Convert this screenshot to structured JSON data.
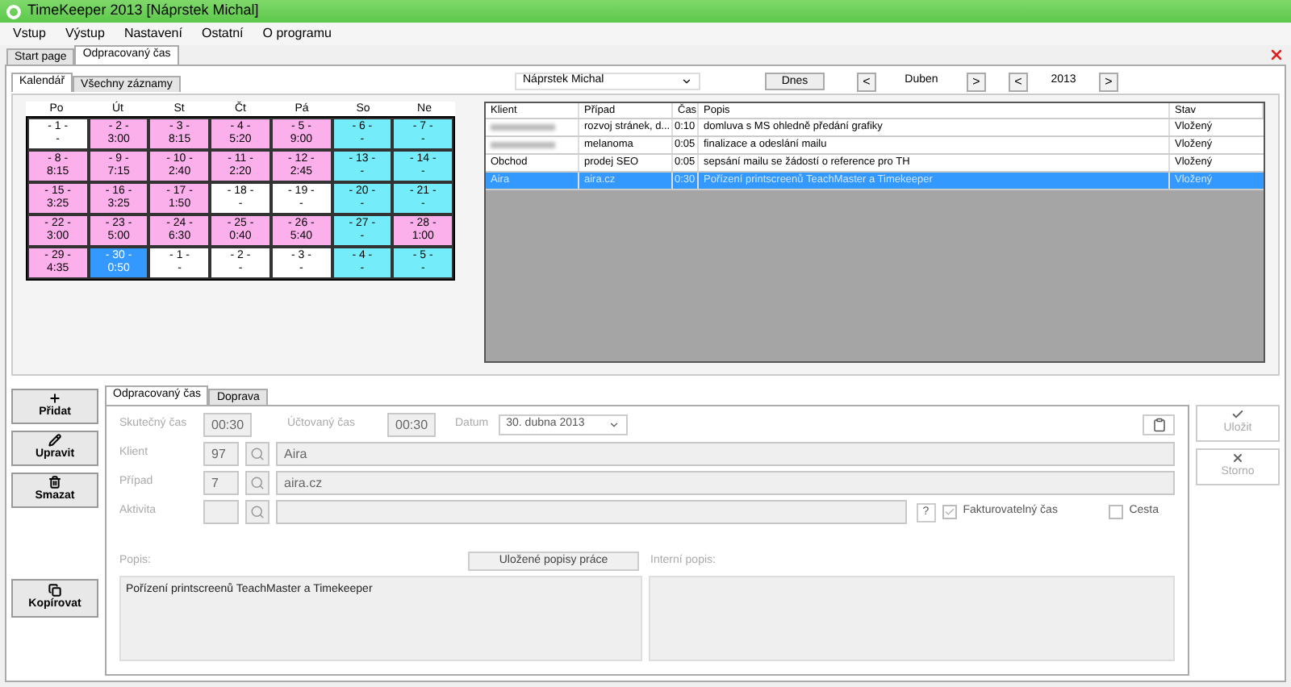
{
  "window": {
    "title": "TimeKeeper 2013 [Náprstek Michal]"
  },
  "menu": [
    "Vstup",
    "Výstup",
    "Nastavení",
    "Ostatní",
    "O programu"
  ],
  "doc_tabs": [
    {
      "label": "Start page",
      "selected": false
    },
    {
      "label": "Odpracovaný čas",
      "selected": true
    }
  ],
  "view_tabs": [
    {
      "label": "Kalendář",
      "selected": true
    },
    {
      "label": "Všechny záznamy",
      "selected": false
    }
  ],
  "user": "Náprstek Michal",
  "today_button": "Dnes",
  "month": {
    "prev": "<",
    "label": "Duben",
    "next": ">"
  },
  "year": {
    "prev": "<",
    "label": "2013",
    "next": ">"
  },
  "weekdays": [
    "Po",
    "Út",
    "St",
    "Čt",
    "Pá",
    "So",
    "Ne"
  ],
  "weeks": [
    [
      {
        "day": "- 1 -",
        "time": "-",
        "kind": "empty",
        "selected": false
      },
      {
        "day": "- 2 -",
        "time": "3:00",
        "kind": "worked",
        "selected": false
      },
      {
        "day": "- 3 -",
        "time": "8:15",
        "kind": "worked",
        "selected": false
      },
      {
        "day": "- 4 -",
        "time": "5:20",
        "kind": "worked",
        "selected": false
      },
      {
        "day": "- 5 -",
        "time": "9:00",
        "kind": "worked",
        "selected": false
      },
      {
        "day": "- 6 -",
        "time": "-",
        "kind": "weekend",
        "selected": false
      },
      {
        "day": "- 7 -",
        "time": "-",
        "kind": "weekend",
        "selected": false
      }
    ],
    [
      {
        "day": "- 8 -",
        "time": "8:15",
        "kind": "worked",
        "selected": false
      },
      {
        "day": "- 9 -",
        "time": "7:15",
        "kind": "worked",
        "selected": false
      },
      {
        "day": "- 10 -",
        "time": "2:40",
        "kind": "worked",
        "selected": false
      },
      {
        "day": "- 11 -",
        "time": "2:20",
        "kind": "worked",
        "selected": false
      },
      {
        "day": "- 12 -",
        "time": "2:45",
        "kind": "worked",
        "selected": false
      },
      {
        "day": "- 13 -",
        "time": "-",
        "kind": "weekend",
        "selected": false
      },
      {
        "day": "- 14 -",
        "time": "-",
        "kind": "weekend",
        "selected": false
      }
    ],
    [
      {
        "day": "- 15 -",
        "time": "3:25",
        "kind": "worked",
        "selected": false
      },
      {
        "day": "- 16 -",
        "time": "3:25",
        "kind": "worked",
        "selected": false
      },
      {
        "day": "- 17 -",
        "time": "1:50",
        "kind": "worked",
        "selected": false
      },
      {
        "day": "- 18 -",
        "time": "-",
        "kind": "empty",
        "selected": false
      },
      {
        "day": "- 19 -",
        "time": "-",
        "kind": "empty",
        "selected": false
      },
      {
        "day": "- 20 -",
        "time": "-",
        "kind": "weekend",
        "selected": false
      },
      {
        "day": "- 21 -",
        "time": "-",
        "kind": "weekend",
        "selected": false
      }
    ],
    [
      {
        "day": "- 22 -",
        "time": "3:00",
        "kind": "worked",
        "selected": false
      },
      {
        "day": "- 23 -",
        "time": "5:00",
        "kind": "worked",
        "selected": false
      },
      {
        "day": "- 24 -",
        "time": "6:30",
        "kind": "worked",
        "selected": false
      },
      {
        "day": "- 25 -",
        "time": "0:40",
        "kind": "worked",
        "selected": false
      },
      {
        "day": "- 26 -",
        "time": "5:40",
        "kind": "worked",
        "selected": false
      },
      {
        "day": "- 27 -",
        "time": "-",
        "kind": "weekend",
        "selected": false
      },
      {
        "day": "- 28 -",
        "time": "1:00",
        "kind": "worked",
        "selected": false
      }
    ],
    [
      {
        "day": "- 29 -",
        "time": "4:35",
        "kind": "worked",
        "selected": false
      },
      {
        "day": "- 30 -",
        "time": "0:50",
        "selected": true
      },
      {
        "day": "- 1 -",
        "time": "-",
        "kind": "empty",
        "selected": false
      },
      {
        "day": "- 2 -",
        "time": "-",
        "kind": "empty",
        "selected": false
      },
      {
        "day": "- 3 -",
        "time": "-",
        "kind": "empty",
        "selected": false
      },
      {
        "day": "- 4 -",
        "time": "-",
        "kind": "weekend",
        "selected": false
      },
      {
        "day": "- 5 -",
        "time": "-",
        "kind": "weekend",
        "selected": false
      }
    ]
  ],
  "table": {
    "columns": [
      "Klient",
      "Případ",
      "Čas",
      "Popis",
      "Stav"
    ],
    "rows": [
      {
        "client_redacted": true,
        "case": "rozvoj stránek, d...",
        "time": "0:10",
        "description": "domluva s MS ohledně předání grafiky",
        "status": "Vložený",
        "selected": false
      },
      {
        "client_redacted": true,
        "case": "melanoma",
        "time": "0:05",
        "description": "finalizace a odeslání mailu",
        "status": "Vložený",
        "selected": false
      },
      {
        "client": "Obchod",
        "client_redacted": false,
        "case": "prodej SEO",
        "time": "0:05",
        "description": "sepsání mailu se žádostí o reference pro TH",
        "status": "Vložený",
        "selected": false
      },
      {
        "client": "Aira",
        "client_redacted": false,
        "case": "aira.cz",
        "time": "0:30",
        "description": "Pořízení printscreenů TeachMaster a Timekeeper",
        "status": "Vložený",
        "selected": true
      }
    ]
  },
  "actions": [
    {
      "label": "Přidat",
      "kind": "add"
    },
    {
      "label": "Upravit",
      "kind": "edit"
    },
    {
      "label": "Smazat",
      "kind": "delete"
    }
  ],
  "copy_button": "Kopírovat",
  "detail_tabs": [
    {
      "label": "Odpracovaný čas",
      "selected": true
    },
    {
      "label": "Doprava",
      "selected": false
    }
  ],
  "form": {
    "actual_time_label": "Skutečný čas",
    "actual_time": "00:30",
    "billed_time_label": "Účtovaný čas",
    "billed_time": "00:30",
    "date_label": "Datum",
    "date": "30.  dubna  2013",
    "client_label": "Klient",
    "client_id": "97",
    "client_name": "Aira",
    "case_label": "Případ",
    "case_id": "7",
    "case_name": "aira.cz",
    "activity_label": "Aktivita",
    "help": "?",
    "billable": {
      "label": "Fakturovatelný čas",
      "checked": true
    },
    "trip": {
      "label": "Cesta",
      "checked": false
    },
    "description_label": "Popis:",
    "saved_button": "Uložené popisy práce",
    "description": "Pořízení printscreenů TeachMaster a Timekeeper",
    "internal_label": "Interní popis:"
  },
  "save_button": "Uložit",
  "cancel_button": "Storno"
}
